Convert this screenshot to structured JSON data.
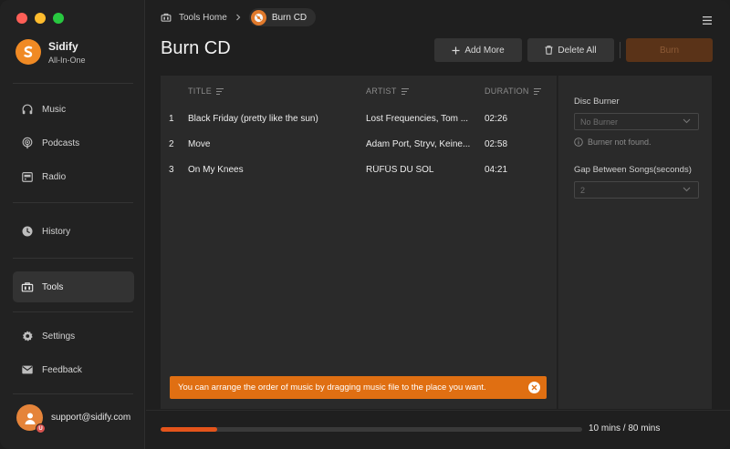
{
  "app": {
    "name": "Sidify",
    "subtitle": "All-In-One"
  },
  "sidebar": {
    "items": [
      {
        "label": "Music",
        "icon": "headphones-icon"
      },
      {
        "label": "Podcasts",
        "icon": "podcast-icon"
      },
      {
        "label": "Radio",
        "icon": "radio-icon"
      },
      {
        "label": "History",
        "icon": "clock-icon"
      },
      {
        "label": "Tools",
        "icon": "toolbox-icon",
        "active": true
      },
      {
        "label": "Settings",
        "icon": "gear-icon"
      },
      {
        "label": "Feedback",
        "icon": "mail-icon"
      }
    ],
    "user_email": "support@sidify.com",
    "user_badge": "U"
  },
  "breadcrumb": {
    "home": "Tools Home",
    "current": "Burn CD"
  },
  "page": {
    "title": "Burn CD",
    "add_label": "Add More",
    "delete_label": "Delete All",
    "burn_label": "Burn"
  },
  "table": {
    "columns": [
      "TITLE",
      "ARTIST",
      "DURATION"
    ],
    "rows": [
      {
        "index": "1",
        "title": "Black Friday (pretty like the sun)",
        "artist": "Lost Frequencies, Tom ...",
        "duration": "02:26"
      },
      {
        "index": "2",
        "title": "Move",
        "artist": "Adam Port, Stryv, Keine...",
        "duration": "02:58"
      },
      {
        "index": "3",
        "title": "On My Knees",
        "artist": "RÜFÜS DU SOL",
        "duration": "04:21"
      }
    ]
  },
  "notice": "You can arrange the order of music by dragging music file to the place you want.",
  "settings": {
    "burner_label": "Disc Burner",
    "burner_value": "No Burner",
    "burner_status": "Burner not found.",
    "gap_label": "Gap Between Songs(seconds)",
    "gap_value": "2"
  },
  "progress": {
    "text": "10 mins / 80 mins",
    "fraction": 0.135
  },
  "colors": {
    "accent": "#e06f12",
    "progress": "#e4541b"
  }
}
